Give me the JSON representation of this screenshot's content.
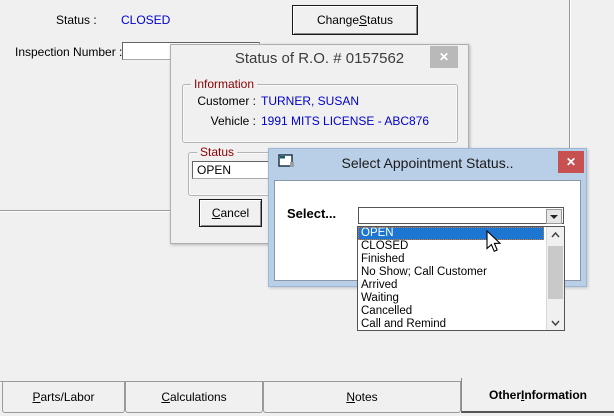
{
  "window": {
    "status_label": "Status :",
    "status_value": "CLOSED",
    "change_status_button": {
      "label": "Change Status",
      "mnemonic": 7
    },
    "inspection_label": "Inspection Number :",
    "inspection_value": ""
  },
  "ro_dialog": {
    "title": "Status of R.O. # 0157562",
    "close_icon": "✕",
    "info_group_label": "Information",
    "customer_label": "Customer :",
    "customer_value": "TURNER, SUSAN",
    "vehicle_label": "Vehicle :",
    "vehicle_value": "1991 MITS LICENSE - ABC876",
    "status_group_label": "Status",
    "status_combo_value": "OPEN",
    "cancel_button": {
      "label": "Cancel",
      "mnemonic": 0
    }
  },
  "appt_dialog": {
    "title": "Select Appointment Status..",
    "close_icon": "✕",
    "select_label": "Select...",
    "combo_value": "",
    "selected_index": 0,
    "options": [
      "OPEN",
      "CLOSED",
      "Finished",
      "No Show; Call Customer",
      "Arrived",
      "Waiting",
      "Cancelled",
      "Call and Remind"
    ]
  },
  "tabs": [
    {
      "label": "Parts/Labor",
      "mnemonic": 0,
      "active": false
    },
    {
      "label": "Calculations",
      "mnemonic": 0,
      "active": false
    },
    {
      "label": "Notes",
      "mnemonic": 0,
      "active": false
    },
    {
      "label": "Other Information",
      "mnemonic": 6,
      "active": true
    }
  ],
  "colors": {
    "background": "#f0f0f0",
    "value_blue": "#0000cc",
    "group_label_red": "#8b0000",
    "appt_titlebar_blue": "#b9cfe8",
    "close_red": "#c75050",
    "selection_blue": "#1d76d2",
    "inactive_close_gray": "#b9b9b9"
  }
}
